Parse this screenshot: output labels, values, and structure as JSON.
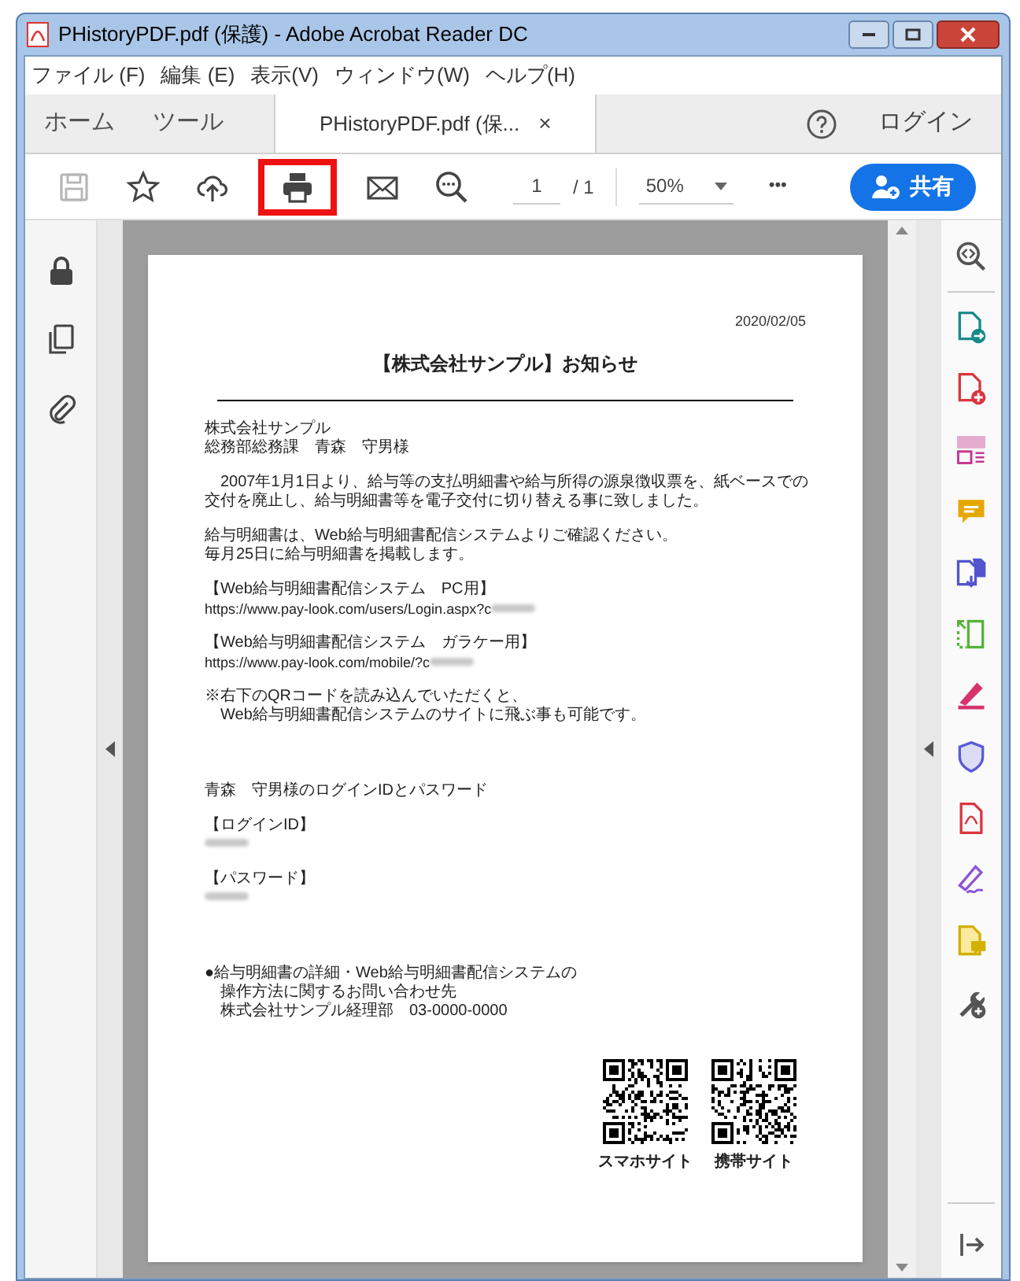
{
  "window": {
    "title": "PHistoryPDF.pdf (保護) - Adobe Acrobat Reader DC"
  },
  "menu": [
    "ファイル (F)",
    "編集 (E)",
    "表示(V)",
    "ウィンドウ(W)",
    "ヘルプ(H)"
  ],
  "tabs": [
    {
      "label": "ホーム",
      "selected": false
    },
    {
      "label": "ツール",
      "selected": false
    },
    {
      "label": "PHistoryPDF.pdf (保...",
      "selected": true,
      "close": "×"
    }
  ],
  "login": "ログイン",
  "toolbar": {
    "tools": [
      {
        "kind": "save",
        "disabled": true,
        "highlighted": false
      },
      {
        "kind": "bookmark",
        "disabled": false,
        "highlighted": false
      },
      {
        "kind": "upload",
        "disabled": false,
        "highlighted": false
      },
      {
        "kind": "print",
        "disabled": false,
        "highlighted": true
      },
      {
        "kind": "mail",
        "disabled": false,
        "highlighted": false
      },
      {
        "kind": "zoom",
        "disabled": false,
        "highlighted": false
      }
    ],
    "page": "1",
    "total": "/ 1",
    "zoom": "50%",
    "more": "•••",
    "share": "共有"
  },
  "document": {
    "date": "2020/02/05",
    "title": "【株式会社サンプル】お知らせ",
    "blocks": [
      {
        "kind": "para",
        "lines": [
          "株式会社サンプル",
          "総務部総務課　青森　守男様"
        ]
      },
      {
        "kind": "para",
        "lines": [
          "　2007年1月1日より、給与等の支払明細書や給与所得の源泉徴収票を、紙ベースでの",
          "交付を廃止し、給与明細書等を電子交付に切り替える事に致しました。"
        ]
      },
      {
        "kind": "para",
        "lines": [
          "給与明細書は、Web給与明細書配信システムよりご確認ください。",
          "毎月25日に給与明細書を掲載します。"
        ]
      },
      {
        "kind": "link",
        "heading": "【Web給与明細書配信システム　PC用】",
        "url": "https://www.pay-look.com/users/Login.aspx?c",
        "redacted": true
      },
      {
        "kind": "link",
        "heading": "【Web給与明細書配信システム　ガラケー用】",
        "url": "https://www.pay-look.com/mobile/?c",
        "redacted": true
      },
      {
        "kind": "para",
        "lines": [
          "※右下のQRコードを読み込んでいただくと、",
          "　Web給与明細書配信システムのサイトに飛ぶ事も可能です。"
        ]
      },
      {
        "kind": "gap"
      },
      {
        "kind": "para",
        "lines": [
          "青森　守男様のログインIDとパスワード"
        ]
      },
      {
        "kind": "secret",
        "heading": "【ログインID】",
        "redacted": true
      },
      {
        "kind": "secret",
        "heading": "【パスワード】",
        "redacted": true
      },
      {
        "kind": "gap"
      },
      {
        "kind": "para",
        "lines": [
          "●給与明細書の詳細・Web給与明細書配信システムの",
          "　操作方法に関するお問い合わせ先",
          "　株式会社サンプル経理部　03-0000-0000"
        ]
      }
    ],
    "qr_codes": [
      {
        "label": "スマホサイト"
      },
      {
        "label": "携帯サイト"
      }
    ]
  }
}
